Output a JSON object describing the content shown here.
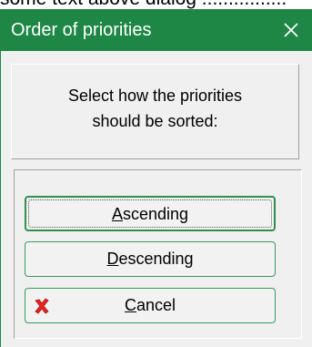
{
  "window": {
    "title": "Order of priorities",
    "close_glyph": "✕"
  },
  "message": {
    "line1": "Select how the priorities",
    "line2": "should be sorted:"
  },
  "buttons": {
    "ascending": {
      "mnemonic": "A",
      "rest": "scending"
    },
    "descending": {
      "mnemonic": "D",
      "rest": "escending"
    },
    "cancel": {
      "mnemonic": "C",
      "rest": "ancel",
      "icon": "red-x-icon"
    }
  },
  "colors": {
    "titlebar": "#1e8745",
    "title_text": "#ffffff",
    "dialog_bg": "#f0f0f0",
    "button_border": "#3b9a5a",
    "cancel_icon": "#e8231f"
  }
}
